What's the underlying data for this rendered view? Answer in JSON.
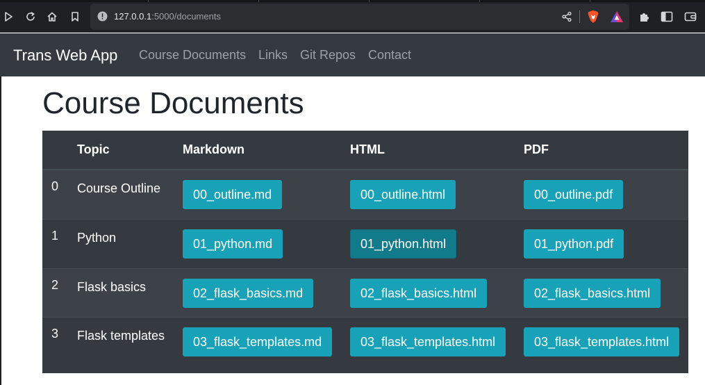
{
  "browser": {
    "url_host": "127.0.0.1",
    "url_rest": ":5000/documents",
    "icons": [
      "play-icon",
      "reload-icon",
      "home-icon",
      "bookmark-icon",
      "info-icon",
      "share-icon",
      "brave-shield-icon",
      "brave-rewards-icon",
      "extensions-icon",
      "sidebar-icon",
      "wallet-icon"
    ]
  },
  "navbar": {
    "brand": "Trans Web App",
    "links": [
      "Course Documents",
      "Links",
      "Git Repos",
      "Contact"
    ]
  },
  "page": {
    "title": "Course Documents"
  },
  "table": {
    "headers": [
      "",
      "Topic",
      "Markdown",
      "HTML",
      "PDF"
    ],
    "rows": [
      {
        "num": "0",
        "topic": "Course Outline",
        "md": "00_outline.md",
        "html": "00_outline.html",
        "pdf": "00_outline.pdf"
      },
      {
        "num": "1",
        "topic": "Python",
        "md": "01_python.md",
        "html": "01_python.html",
        "pdf": "01_python.pdf"
      },
      {
        "num": "2",
        "topic": "Flask basics",
        "md": "02_flask_basics.md",
        "html": "02_flask_basics.html",
        "pdf": "02_flask_basics.html"
      },
      {
        "num": "3",
        "topic": "Flask templates",
        "md": "03_flask_templates.md",
        "html": "03_flask_templates.html",
        "pdf": "03_flask_templates.html"
      }
    ]
  },
  "colors": {
    "navbar_bg": "#343a40",
    "button_info": "#17a2b8",
    "button_active": "#117a8b"
  }
}
